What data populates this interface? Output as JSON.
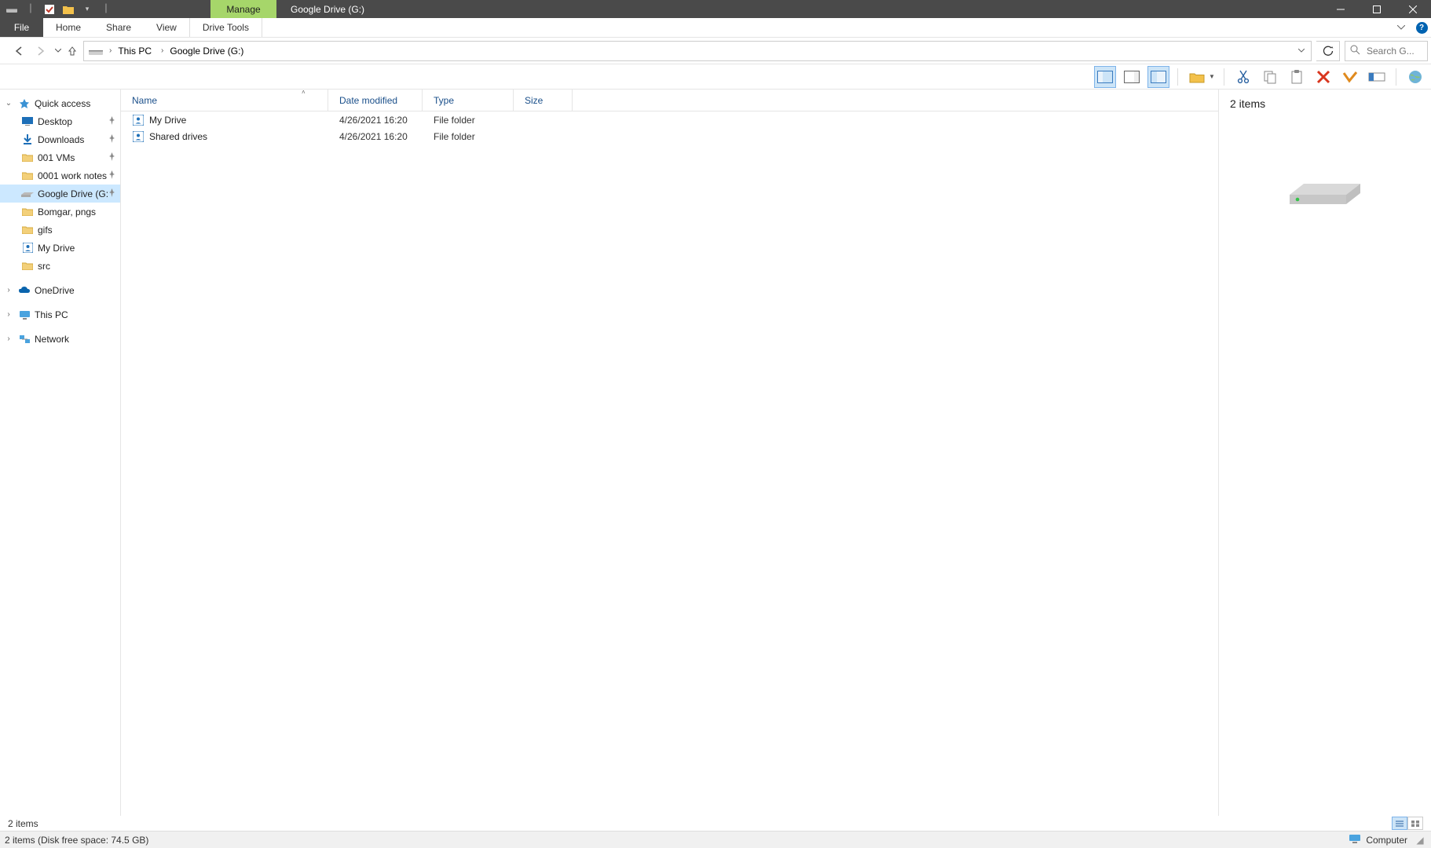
{
  "titlebar": {
    "context_tab": "Manage",
    "window_title": "Google Drive (G:)"
  },
  "ribbon": {
    "file": "File",
    "tabs": [
      "Home",
      "Share",
      "View"
    ],
    "context_tabs": [
      "Drive Tools"
    ]
  },
  "nav": {
    "breadcrumbs": [
      "This PC",
      "Google Drive (G:)"
    ]
  },
  "search": {
    "placeholder": "Search G..."
  },
  "tree": {
    "quick_access": "Quick access",
    "quick_items": [
      {
        "label": "Desktop",
        "pinned": true,
        "icon": "desktop"
      },
      {
        "label": "Downloads",
        "pinned": true,
        "icon": "downloads"
      },
      {
        "label": "001 VMs",
        "pinned": true,
        "icon": "folder-y"
      },
      {
        "label": "0001 work notes",
        "pinned": true,
        "icon": "folder-y"
      },
      {
        "label": "Google Drive (G:",
        "pinned": true,
        "icon": "drive",
        "selected": true
      },
      {
        "label": "Bomgar, pngs",
        "pinned": false,
        "icon": "folder-y"
      },
      {
        "label": "gifs",
        "pinned": false,
        "icon": "folder-y"
      },
      {
        "label": "My Drive",
        "pinned": false,
        "icon": "gd-blue"
      },
      {
        "label": "src",
        "pinned": false,
        "icon": "folder-y"
      }
    ],
    "onedrive": "OneDrive",
    "this_pc": "This PC",
    "network": "Network"
  },
  "columns": {
    "name": "Name",
    "date": "Date modified",
    "type": "Type",
    "size": "Size"
  },
  "rows": [
    {
      "name": "My Drive",
      "date": "4/26/2021 16:20",
      "type": "File folder",
      "size": ""
    },
    {
      "name": "Shared drives",
      "date": "4/26/2021 16:20",
      "type": "File folder",
      "size": ""
    }
  ],
  "details": {
    "count": "2 items"
  },
  "status1": {
    "left": "2 items"
  },
  "status2": {
    "left": "2 items (Disk free space: 74.5 GB)",
    "location": "Computer"
  }
}
